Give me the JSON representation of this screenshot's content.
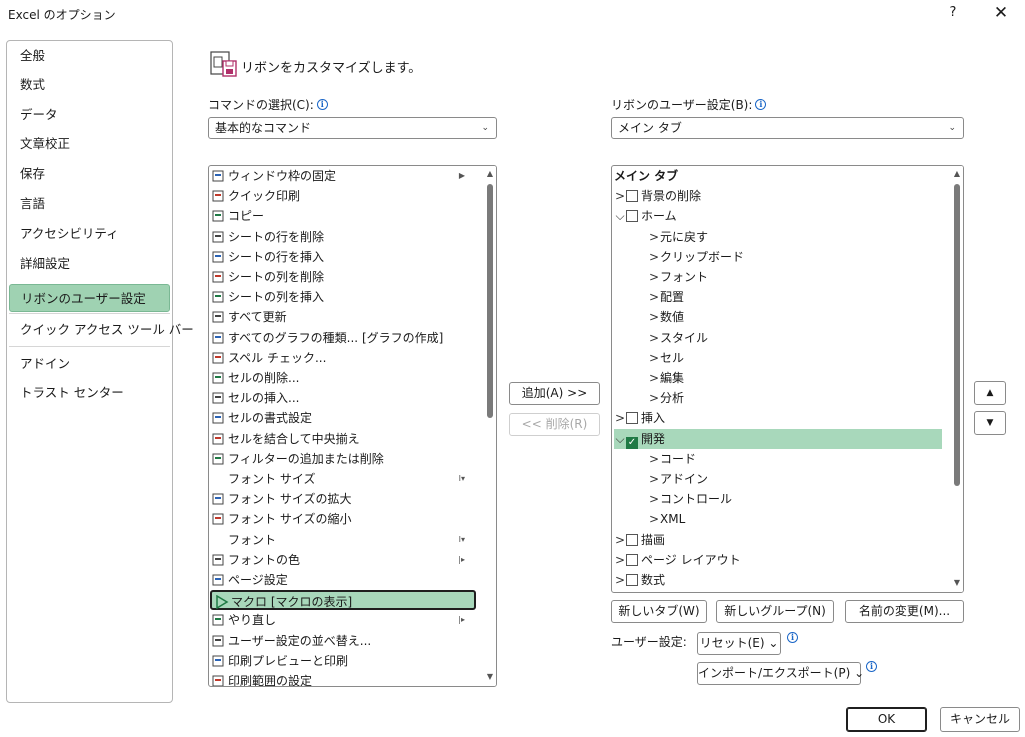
{
  "window": {
    "title": "Excel のオプション",
    "help": "?",
    "close": "✕"
  },
  "nav": {
    "items": [
      {
        "label": "全般"
      },
      {
        "label": "数式"
      },
      {
        "label": "データ"
      },
      {
        "label": "文章校正"
      },
      {
        "label": "保存"
      },
      {
        "label": "言語"
      },
      {
        "label": "アクセシビリティ"
      },
      {
        "label": "詳細設定"
      },
      {
        "label": "リボンのユーザー設定",
        "active": true
      },
      {
        "label": "クイック アクセス ツール バー"
      },
      {
        "label": "アドイン"
      },
      {
        "label": "トラスト センター"
      }
    ]
  },
  "header": {
    "text": "リボンをカスタマイズします。",
    "icon": "ribbon-customize-icon"
  },
  "left": {
    "choose_label": "コマンドの選択(C):",
    "choose_value": "基本的なコマンド",
    "commands": [
      {
        "label": "ウィンドウ枠の固定",
        "sub": "▶",
        "icon": "freeze-panes-icon"
      },
      {
        "label": "クイック印刷",
        "icon": "quick-print-icon"
      },
      {
        "label": "コピー",
        "icon": "copy-icon"
      },
      {
        "label": "シートの行を削除",
        "icon": "delete-row-icon"
      },
      {
        "label": "シートの行を挿入",
        "icon": "insert-row-icon"
      },
      {
        "label": "シートの列を削除",
        "icon": "delete-column-icon"
      },
      {
        "label": "シートの列を挿入",
        "icon": "insert-column-icon"
      },
      {
        "label": "すべて更新",
        "icon": "refresh-all-icon"
      },
      {
        "label": "すべてのグラフの種類... [グラフの作成]",
        "icon": "chart-icon"
      },
      {
        "label": "スペル チェック...",
        "icon": "spelling-icon"
      },
      {
        "label": "セルの削除...",
        "icon": "delete-cells-icon"
      },
      {
        "label": "セルの挿入...",
        "icon": "insert-cells-icon"
      },
      {
        "label": "セルの書式設定",
        "icon": "format-cells-icon"
      },
      {
        "label": "セルを結合して中央揃え",
        "icon": "merge-center-icon"
      },
      {
        "label": "フィルターの追加または削除",
        "icon": "filter-icon"
      },
      {
        "label": "フォント サイズ",
        "sub": "I▾",
        "icon": "none",
        "indent": true
      },
      {
        "label": "フォント サイズの拡大",
        "icon": "font-grow-icon"
      },
      {
        "label": "フォント サイズの縮小",
        "icon": "font-shrink-icon"
      },
      {
        "label": "フォント",
        "sub": "I▾",
        "icon": "none",
        "indent": true
      },
      {
        "label": "フォントの色",
        "sub": "|▸",
        "icon": "font-color-icon"
      },
      {
        "label": "ページ設定",
        "icon": "page-setup-icon"
      },
      {
        "label": "マクロ [マクロの表示]",
        "icon": "macro-icon",
        "selected": true
      },
      {
        "label": "やり直し",
        "sub": "|▸",
        "icon": "redo-icon"
      },
      {
        "label": "ユーザー設定の並べ替え...",
        "icon": "custom-sort-icon"
      },
      {
        "label": "印刷プレビューと印刷",
        "icon": "print-preview-icon"
      },
      {
        "label": "印刷範囲の設定",
        "icon": "print-area-icon"
      }
    ]
  },
  "middle": {
    "add": "追加(A) >>",
    "remove": "<< 削除(R)"
  },
  "right": {
    "customize_label": "リボンのユーザー設定(B):",
    "customize_value": "メイン タブ",
    "tree": [
      {
        "label": "メイン タブ",
        "level": 0,
        "header": true
      },
      {
        "label": "背景の削除",
        "level": 1,
        "chevron": "›",
        "check": false
      },
      {
        "label": "ホーム",
        "level": 1,
        "chevron": "⌄",
        "check": false
      },
      {
        "label": "元に戻す",
        "level": 2,
        "chevron": "›"
      },
      {
        "label": "クリップボード",
        "level": 2,
        "chevron": "›"
      },
      {
        "label": "フォント",
        "level": 2,
        "chevron": "›"
      },
      {
        "label": "配置",
        "level": 2,
        "chevron": "›"
      },
      {
        "label": "数値",
        "level": 2,
        "chevron": "›"
      },
      {
        "label": "スタイル",
        "level": 2,
        "chevron": "›"
      },
      {
        "label": "セル",
        "level": 2,
        "chevron": "›"
      },
      {
        "label": "編集",
        "level": 2,
        "chevron": "›"
      },
      {
        "label": "分析",
        "level": 2,
        "chevron": "›"
      },
      {
        "label": "挿入",
        "level": 1,
        "chevron": "›",
        "check": false
      },
      {
        "label": "開発",
        "level": 1,
        "chevron": "⌄",
        "check": true,
        "highlight": true
      },
      {
        "label": "コード",
        "level": 2,
        "chevron": "›"
      },
      {
        "label": "アドイン",
        "level": 2,
        "chevron": "›"
      },
      {
        "label": "コントロール",
        "level": 2,
        "chevron": "›"
      },
      {
        "label": "XML",
        "level": 2,
        "chevron": "›"
      },
      {
        "label": "描画",
        "level": 1,
        "chevron": "›",
        "check": false
      },
      {
        "label": "ページ レイアウト",
        "level": 1,
        "chevron": "›",
        "check": false
      },
      {
        "label": "数式",
        "level": 1,
        "chevron": "›",
        "check": false
      }
    ],
    "new_tab": "新しいタブ(W)",
    "new_group": "新しいグループ(N)",
    "rename": "名前の変更(M)...",
    "user_setting_label": "ユーザー設定:",
    "reset": "リセット(E) ⌄",
    "import_export": "インポート/エクスポート(P) ⌄",
    "move_up": "▲",
    "move_down": "▼"
  },
  "footer": {
    "ok": "OK",
    "cancel": "キャンセル"
  }
}
